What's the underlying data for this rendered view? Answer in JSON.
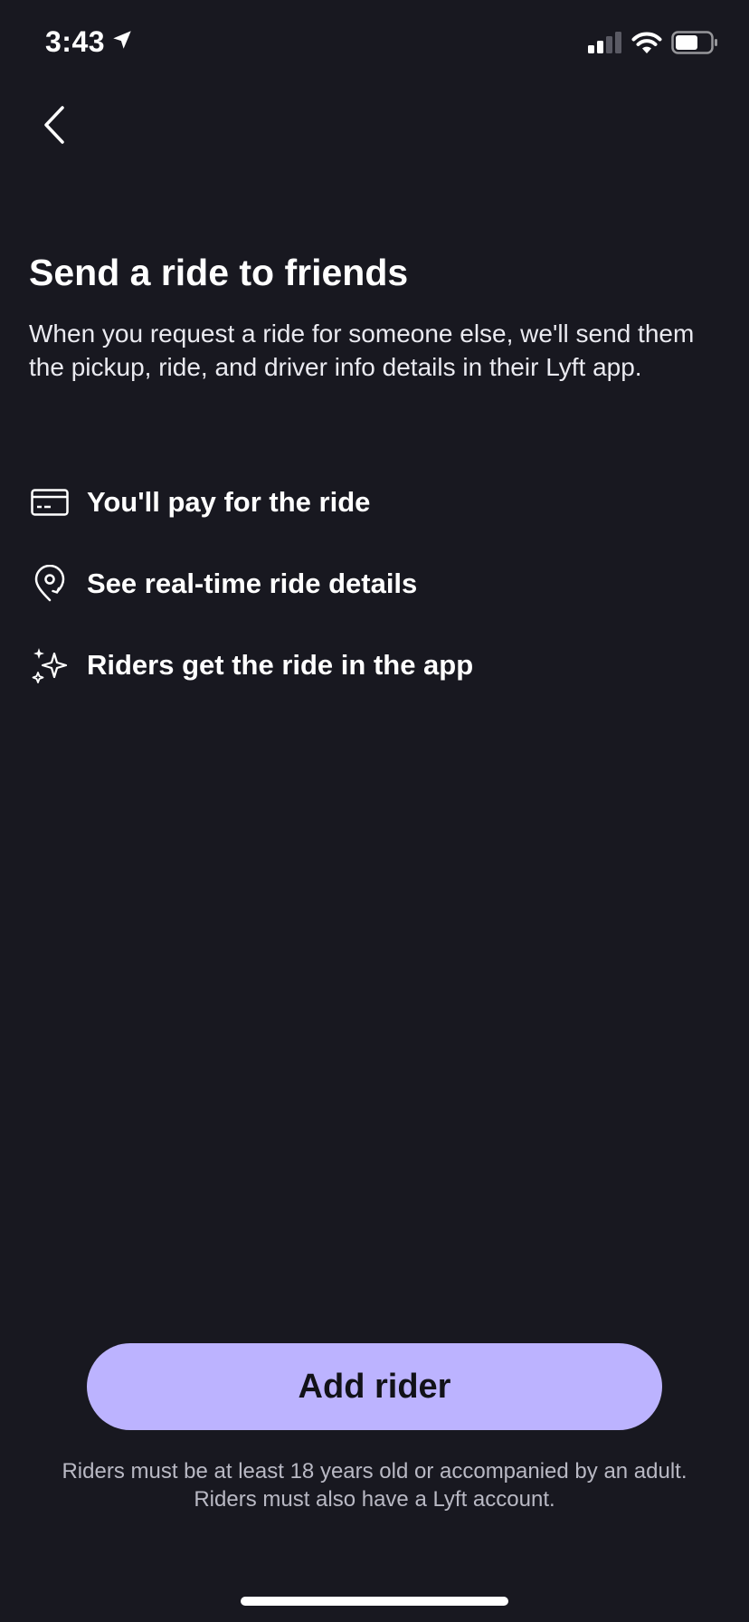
{
  "status_bar": {
    "time": "3:43",
    "icons": [
      "location-arrow-icon",
      "signal-icon",
      "wifi-icon",
      "battery-icon"
    ]
  },
  "nav": {
    "back_icon": "chevron-left-icon"
  },
  "content": {
    "title": "Send a ride to friends",
    "subtitle": "When you request a ride for someone else, we'll send them the pickup, ride, and driver info details in their Lyft app.",
    "features": [
      {
        "icon": "credit-card-icon",
        "label": "You'll pay for the ride"
      },
      {
        "icon": "location-pin-refresh-icon",
        "label": "See real-time ride details"
      },
      {
        "icon": "sparkles-icon",
        "label": "Riders get the ride in the app"
      }
    ]
  },
  "cta": {
    "label": "Add rider"
  },
  "disclaimer": {
    "line1": "Riders must be at least 18 years old or accompanied by an adult.",
    "line2": "Riders must also have a Lyft account."
  },
  "colors": {
    "background": "#181820",
    "accent": "#bcb3ff",
    "text": "#ffffff",
    "muted_text": "#b9b9c4"
  }
}
